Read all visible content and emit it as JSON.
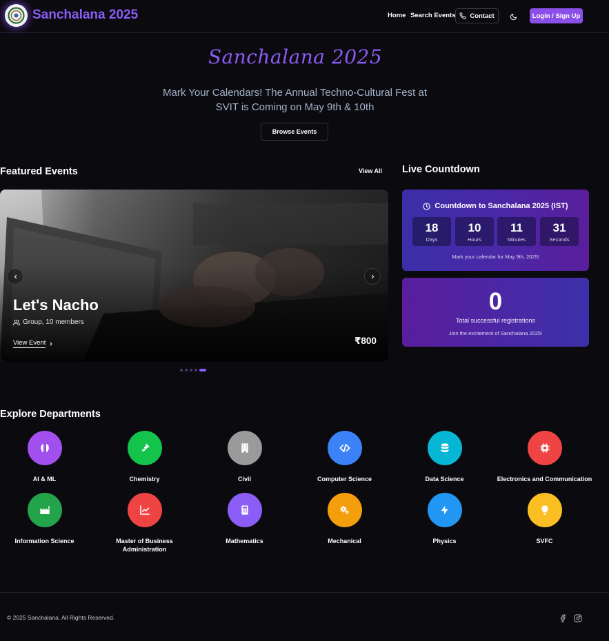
{
  "nav": {
    "brand": "Sanchalana 2025",
    "links": [
      "Home",
      "Search Events"
    ],
    "contact_label": "Contact",
    "login_label": "Login / Sign Up"
  },
  "hero": {
    "title": "Sanchalana 2025",
    "subtitle": "Mark Your Calendars! The Annual Techno-Cultural Fest at SVIT is Coming on May 9th & 10th",
    "browse_label": "Browse Events"
  },
  "featured": {
    "heading": "Featured Events",
    "view_all": "View All",
    "event": {
      "title": "Let's Nacho",
      "meta": "Group, 10 members",
      "view_label": "View Event",
      "price": "₹800"
    },
    "slides_count": 5,
    "active_slide": 5
  },
  "countdown": {
    "heading": "Live Countdown",
    "title": "Countdown to Sanchalana 2025 (IST)",
    "units": [
      {
        "value": "18",
        "label": "Days"
      },
      {
        "value": "10",
        "label": "Hours"
      },
      {
        "value": "11",
        "label": "Minutes"
      },
      {
        "value": "31",
        "label": "Seconds"
      }
    ],
    "footer": "Mark your calendar for May 9th, 2025!"
  },
  "registrations": {
    "count": "0",
    "label": "Total successful registrations",
    "sub": "Join the excitement of Sanchalana 2025!"
  },
  "departments": {
    "heading": "Explore Departments",
    "items": [
      {
        "name": "AI & ML",
        "color": "#a24ff0",
        "icon": "brain-icon"
      },
      {
        "name": "Chemistry",
        "color": "#13c34b",
        "icon": "flask-icon"
      },
      {
        "name": "Civil",
        "color": "#9a9a9a",
        "icon": "building-icon"
      },
      {
        "name": "Computer Science",
        "color": "#3b82f6",
        "icon": "code-icon"
      },
      {
        "name": "Data Science",
        "color": "#06b6d4",
        "icon": "database-icon"
      },
      {
        "name": "Electronics and Communication",
        "color": "#ef4444",
        "icon": "chip-icon"
      },
      {
        "name": "Information Science",
        "color": "#23a34a",
        "icon": "factory-icon"
      },
      {
        "name": "Master of Business Administration",
        "color": "#ef4444",
        "icon": "chart-line-icon"
      },
      {
        "name": "Mathematics",
        "color": "#8b5cf6",
        "icon": "calculator-icon"
      },
      {
        "name": "Mechanical",
        "color": "#f59e0b",
        "icon": "gears-icon"
      },
      {
        "name": "Physics",
        "color": "#2196f3",
        "icon": "bolt-icon"
      },
      {
        "name": "SVFC",
        "color": "#fbbf24",
        "icon": "bulb-icon"
      }
    ]
  },
  "footer": {
    "copyright": "© 2025 Sanchalana. All Rights Reserved."
  },
  "colors": {
    "background": "#0b0a0f",
    "accent": "#8b5cf6",
    "login_button": "#8a4fe8"
  }
}
